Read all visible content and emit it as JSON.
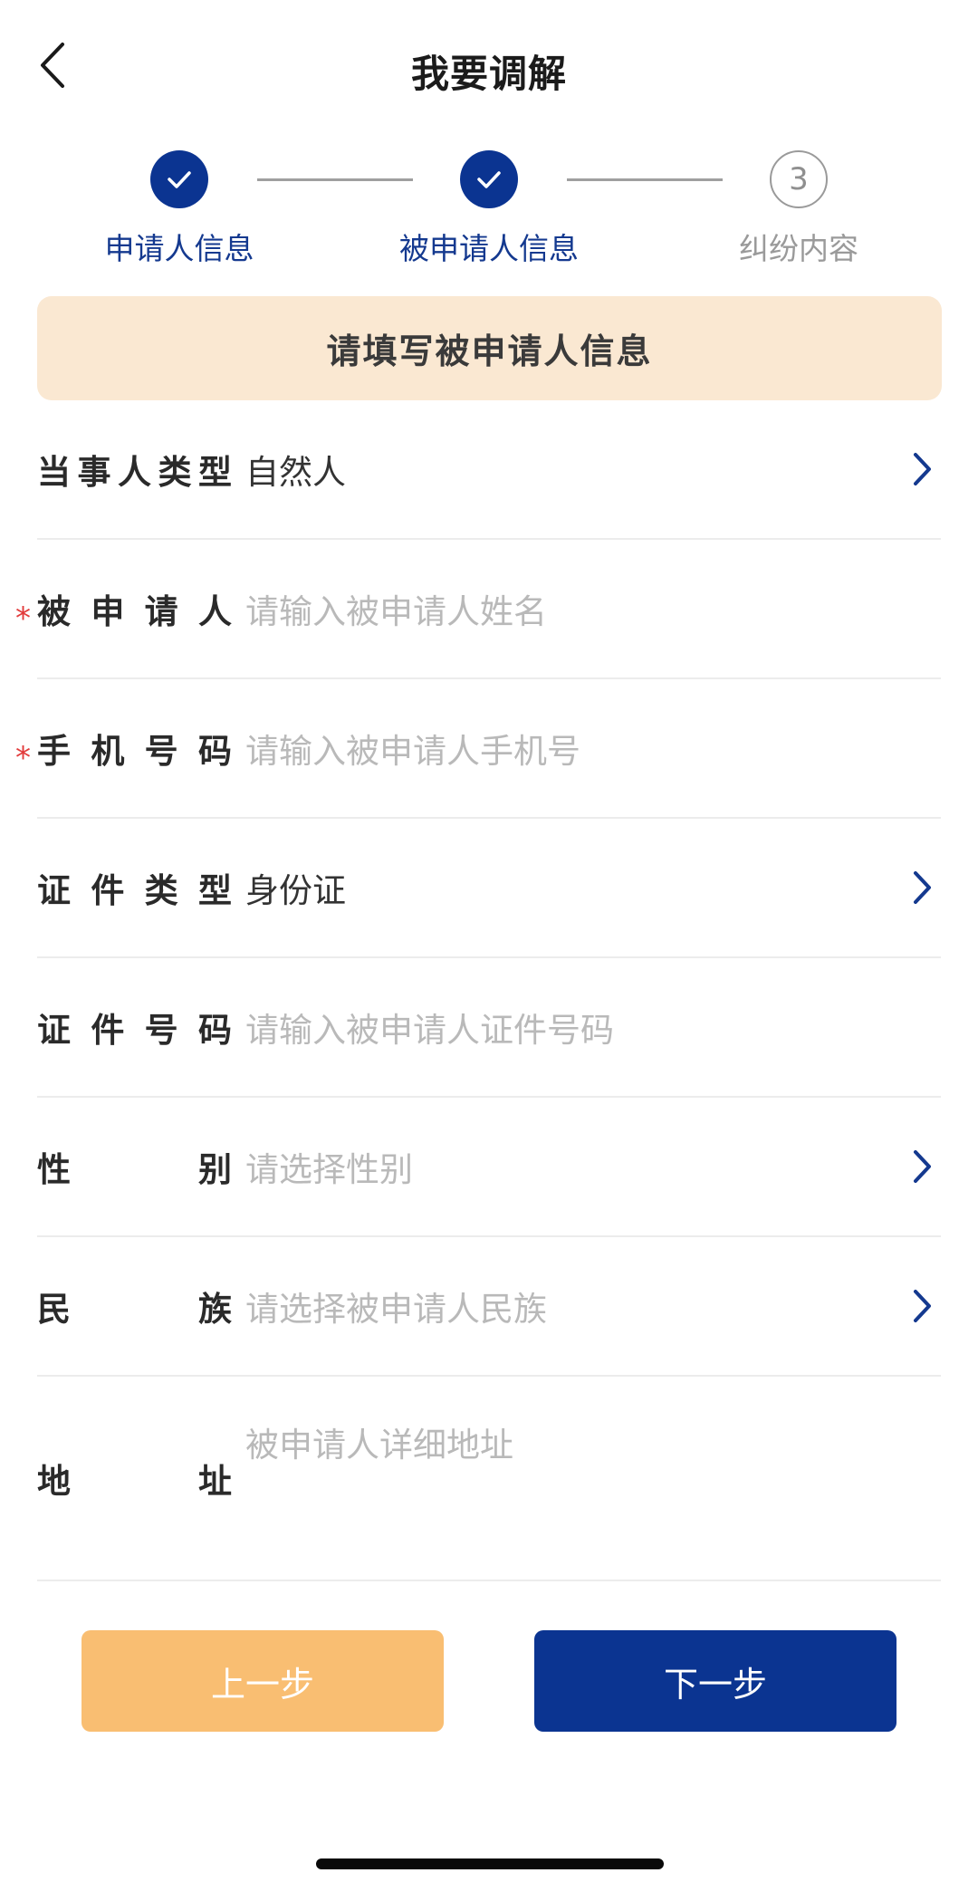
{
  "header": {
    "title": "我要调解",
    "back_icon": "chevron-left-icon"
  },
  "stepper": {
    "steps": [
      {
        "label": "申请人信息",
        "status": "done"
      },
      {
        "label": "被申请人信息",
        "status": "done"
      },
      {
        "label": "纠纷内容",
        "status": "pending",
        "number": "3"
      }
    ],
    "active_color": "#0b3491",
    "pending_color": "#9a9a9a"
  },
  "banner": {
    "text": "请填写被申请人信息",
    "background": "#fae8d2"
  },
  "form": {
    "party_type": {
      "label": [
        "当",
        "事",
        "人",
        "类",
        "型"
      ],
      "value": "自然人"
    },
    "respondent": {
      "label": [
        "被",
        "申",
        "请",
        "人"
      ],
      "placeholder": "请输入被申请人姓名",
      "required": true
    },
    "phone": {
      "label": [
        "手",
        "机",
        "号",
        "码"
      ],
      "placeholder": "请输入被申请人手机号",
      "required": true
    },
    "id_type": {
      "label": [
        "证",
        "件",
        "类",
        "型"
      ],
      "value": "身份证"
    },
    "id_number": {
      "label": [
        "证",
        "件",
        "号",
        "码"
      ],
      "placeholder": "请输入被申请人证件号码"
    },
    "gender": {
      "label": [
        "性",
        "别"
      ],
      "placeholder": "请选择性别"
    },
    "ethnicity": {
      "label": [
        "民",
        "族"
      ],
      "placeholder": "请选择被申请人民族"
    },
    "address": {
      "label": [
        "地",
        "址"
      ],
      "placeholder": "被申请人详细地址"
    },
    "required_mark": "*"
  },
  "buttons": {
    "prev": "上一步",
    "next": "下一步",
    "prev_color": "#f9be72",
    "next_color": "#0b3491"
  }
}
